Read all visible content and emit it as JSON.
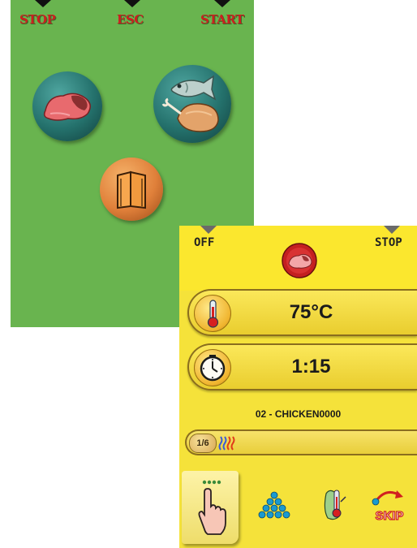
{
  "menu_screen": {
    "top_labels": {
      "stop": "STOP",
      "esc": "ESC",
      "start": "START"
    },
    "buttons": [
      {
        "icon": "meat-icon"
      },
      {
        "icon": "fish-poultry-icon"
      },
      {
        "icon": "recipe-book-icon"
      }
    ],
    "colors": {
      "background": "#69b44f",
      "label": "#cc1f1f",
      "button": "#24716c",
      "book_button": "#e0803a"
    }
  },
  "cooking_screen": {
    "top_labels": {
      "off": "OFF",
      "stop": "STOP"
    },
    "mode_icon": "meat-icon",
    "temperature": {
      "icon": "thermometer-icon",
      "value": "75°C"
    },
    "time": {
      "icon": "clock-icon",
      "value": "1:15"
    },
    "program_name": "02 - CHICKEN0000",
    "progress": {
      "step": "1/6",
      "icon": "heat-waves-icon",
      "fraction": 0.0
    },
    "bottom_buttons": [
      {
        "icon": "touch-hand-icon",
        "active": true
      },
      {
        "icon": "stack-icon"
      },
      {
        "icon": "core-probe-icon"
      },
      {
        "icon": "skip-icon",
        "text": "SKIP"
      }
    ],
    "colors": {
      "background": "#f5e23a",
      "text": "#1b1b1b",
      "accent": "#d02020"
    }
  }
}
